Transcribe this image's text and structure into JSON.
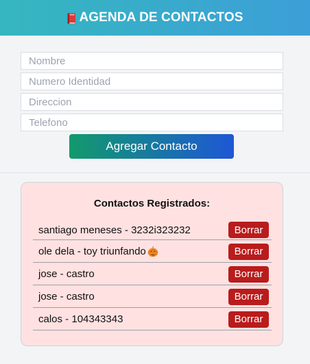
{
  "header": {
    "title": "AGENDA DE CONTACTOS",
    "icon": "book-icon"
  },
  "form": {
    "fields": [
      {
        "name": "nombre",
        "placeholder": "Nombre",
        "value": ""
      },
      {
        "name": "identidad",
        "placeholder": "Numero Identidad",
        "value": ""
      },
      {
        "name": "direccion",
        "placeholder": "Direccion",
        "value": ""
      },
      {
        "name": "telefono",
        "placeholder": "Telefono",
        "value": ""
      }
    ],
    "submit_label": "Agregar Contacto"
  },
  "contacts": {
    "title": "Contactos Registrados:",
    "delete_label": "Borrar",
    "items": [
      {
        "text": "santiago meneses - 3232i323232",
        "emoji": ""
      },
      {
        "text": "ole dela - toy triunfando",
        "emoji": "pumpkin-icon"
      },
      {
        "text": "jose - castro",
        "emoji": ""
      },
      {
        "text": "jose - castro",
        "emoji": ""
      },
      {
        "text": "calos - 104343343",
        "emoji": ""
      }
    ]
  },
  "colors": {
    "header_start": "#35b7bf",
    "header_end": "#3c9fd8",
    "button_start": "#129a6c",
    "button_end": "#1e57d6",
    "panel_bg": "#ffe1e1",
    "delete_bg": "#b91c1c"
  }
}
